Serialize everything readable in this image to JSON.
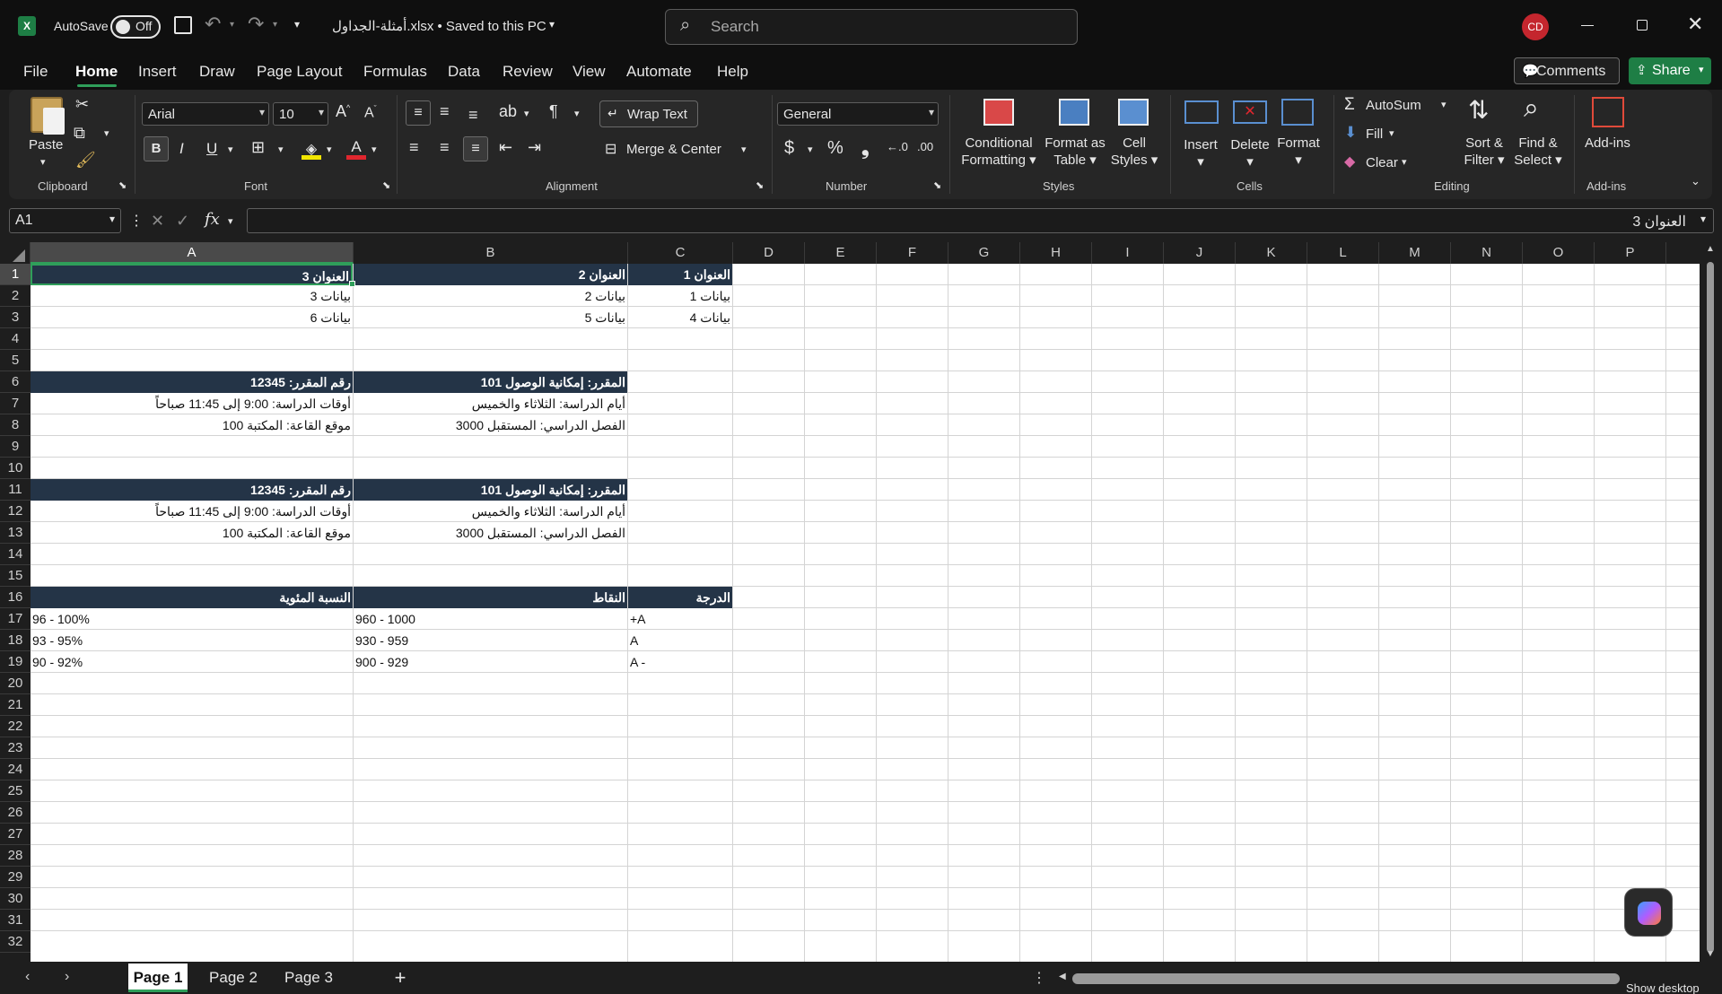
{
  "titlebar": {
    "autosave_label": "AutoSave",
    "autosave_state": "Off",
    "filename": "أمثلة-الجداول.xlsx • Saved to this PC",
    "search_placeholder": "Search",
    "avatar": "CD"
  },
  "menu": {
    "tabs": [
      "File",
      "Home",
      "Insert",
      "Draw",
      "Page Layout",
      "Formulas",
      "Data",
      "Review",
      "View",
      "Automate",
      "Help"
    ],
    "active": "Home",
    "comments": "Comments",
    "share": "Share"
  },
  "ribbon": {
    "clipboard": {
      "label": "Clipboard",
      "paste": "Paste"
    },
    "font": {
      "label": "Font",
      "family": "Arial",
      "size": "10",
      "bold": "B",
      "italic": "I",
      "underline": "U"
    },
    "alignment": {
      "label": "Alignment",
      "wrap": "Wrap Text",
      "merge": "Merge & Center"
    },
    "number": {
      "label": "Number",
      "format": "General",
      "dollar": "$",
      "percent": "%"
    },
    "styles": {
      "label": "Styles",
      "conditional": [
        "Conditional",
        "Formatting"
      ],
      "format_table": [
        "Format as",
        "Table"
      ],
      "cell_styles": [
        "Cell",
        "Styles"
      ]
    },
    "cells": {
      "label": "Cells",
      "insert": "Insert",
      "delete": "Delete",
      "format": "Format"
    },
    "editing": {
      "label": "Editing",
      "autosum": "AutoSum",
      "fill": "Fill",
      "clear": "Clear",
      "sort": [
        "Sort &",
        "Filter"
      ],
      "find": [
        "Find &",
        "Select"
      ]
    },
    "addins": {
      "label": "Add-ins",
      "button": "Add-ins"
    }
  },
  "formulabar": {
    "namebox": "A1",
    "content": "العنوان 3"
  },
  "columns": [
    "A",
    "B",
    "C",
    "D",
    "E",
    "F",
    "G",
    "H",
    "I",
    "J",
    "K",
    "L",
    "M",
    "N",
    "O",
    "P"
  ],
  "rows": [
    "1",
    "2",
    "3",
    "4",
    "5",
    "6",
    "7",
    "8",
    "9",
    "10",
    "11",
    "12",
    "13",
    "14",
    "15",
    "16",
    "17",
    "18",
    "19",
    "20",
    "21",
    "22",
    "23",
    "24",
    "25",
    "26",
    "27",
    "28",
    "29",
    "30",
    "31",
    "32"
  ],
  "cells": {
    "r1": [
      "العنوان 3",
      "العنوان 2",
      "العنوان 1"
    ],
    "r2": [
      "بيانات 3",
      "بيانات 2",
      "بيانات 1"
    ],
    "r3": [
      "بيانات 6",
      "بيانات 5",
      "بيانات 4"
    ],
    "r6": [
      "رقم المقرر: 12345",
      "المقرر: إمكانية الوصول 101"
    ],
    "r7": [
      "أوقات الدراسة: 9:00 إلى 11:45 صباحاً",
      "أيام الدراسة: الثلاثاء والخميس"
    ],
    "r8": [
      "موقع القاعة: المكتبة 100",
      "الفصل الدراسي: المستقبل 3000"
    ],
    "r11": [
      "رقم المقرر: 12345",
      "المقرر: إمكانية الوصول 101"
    ],
    "r12": [
      "أوقات الدراسة: 9:00 إلى 11:45 صباحاً",
      "أيام الدراسة: الثلاثاء والخميس"
    ],
    "r13": [
      "موقع القاعة: المكتبة 100",
      "الفصل الدراسي: المستقبل 3000"
    ],
    "r16": [
      "النسبة المئوية",
      "النقاط",
      "الدرجة"
    ],
    "r17": [
      "96 - 100%",
      "960 - 1000",
      "+A"
    ],
    "r18": [
      "93 - 95%",
      "930 - 959",
      "A"
    ],
    "r19": [
      "90 - 92%",
      "900 - 929",
      "A -"
    ]
  },
  "sheets": {
    "tabs": [
      "Page 1",
      "Page 2",
      "Page 3"
    ],
    "active": "Page 1",
    "add": "+"
  },
  "taskbar_hint": "Show desktop"
}
